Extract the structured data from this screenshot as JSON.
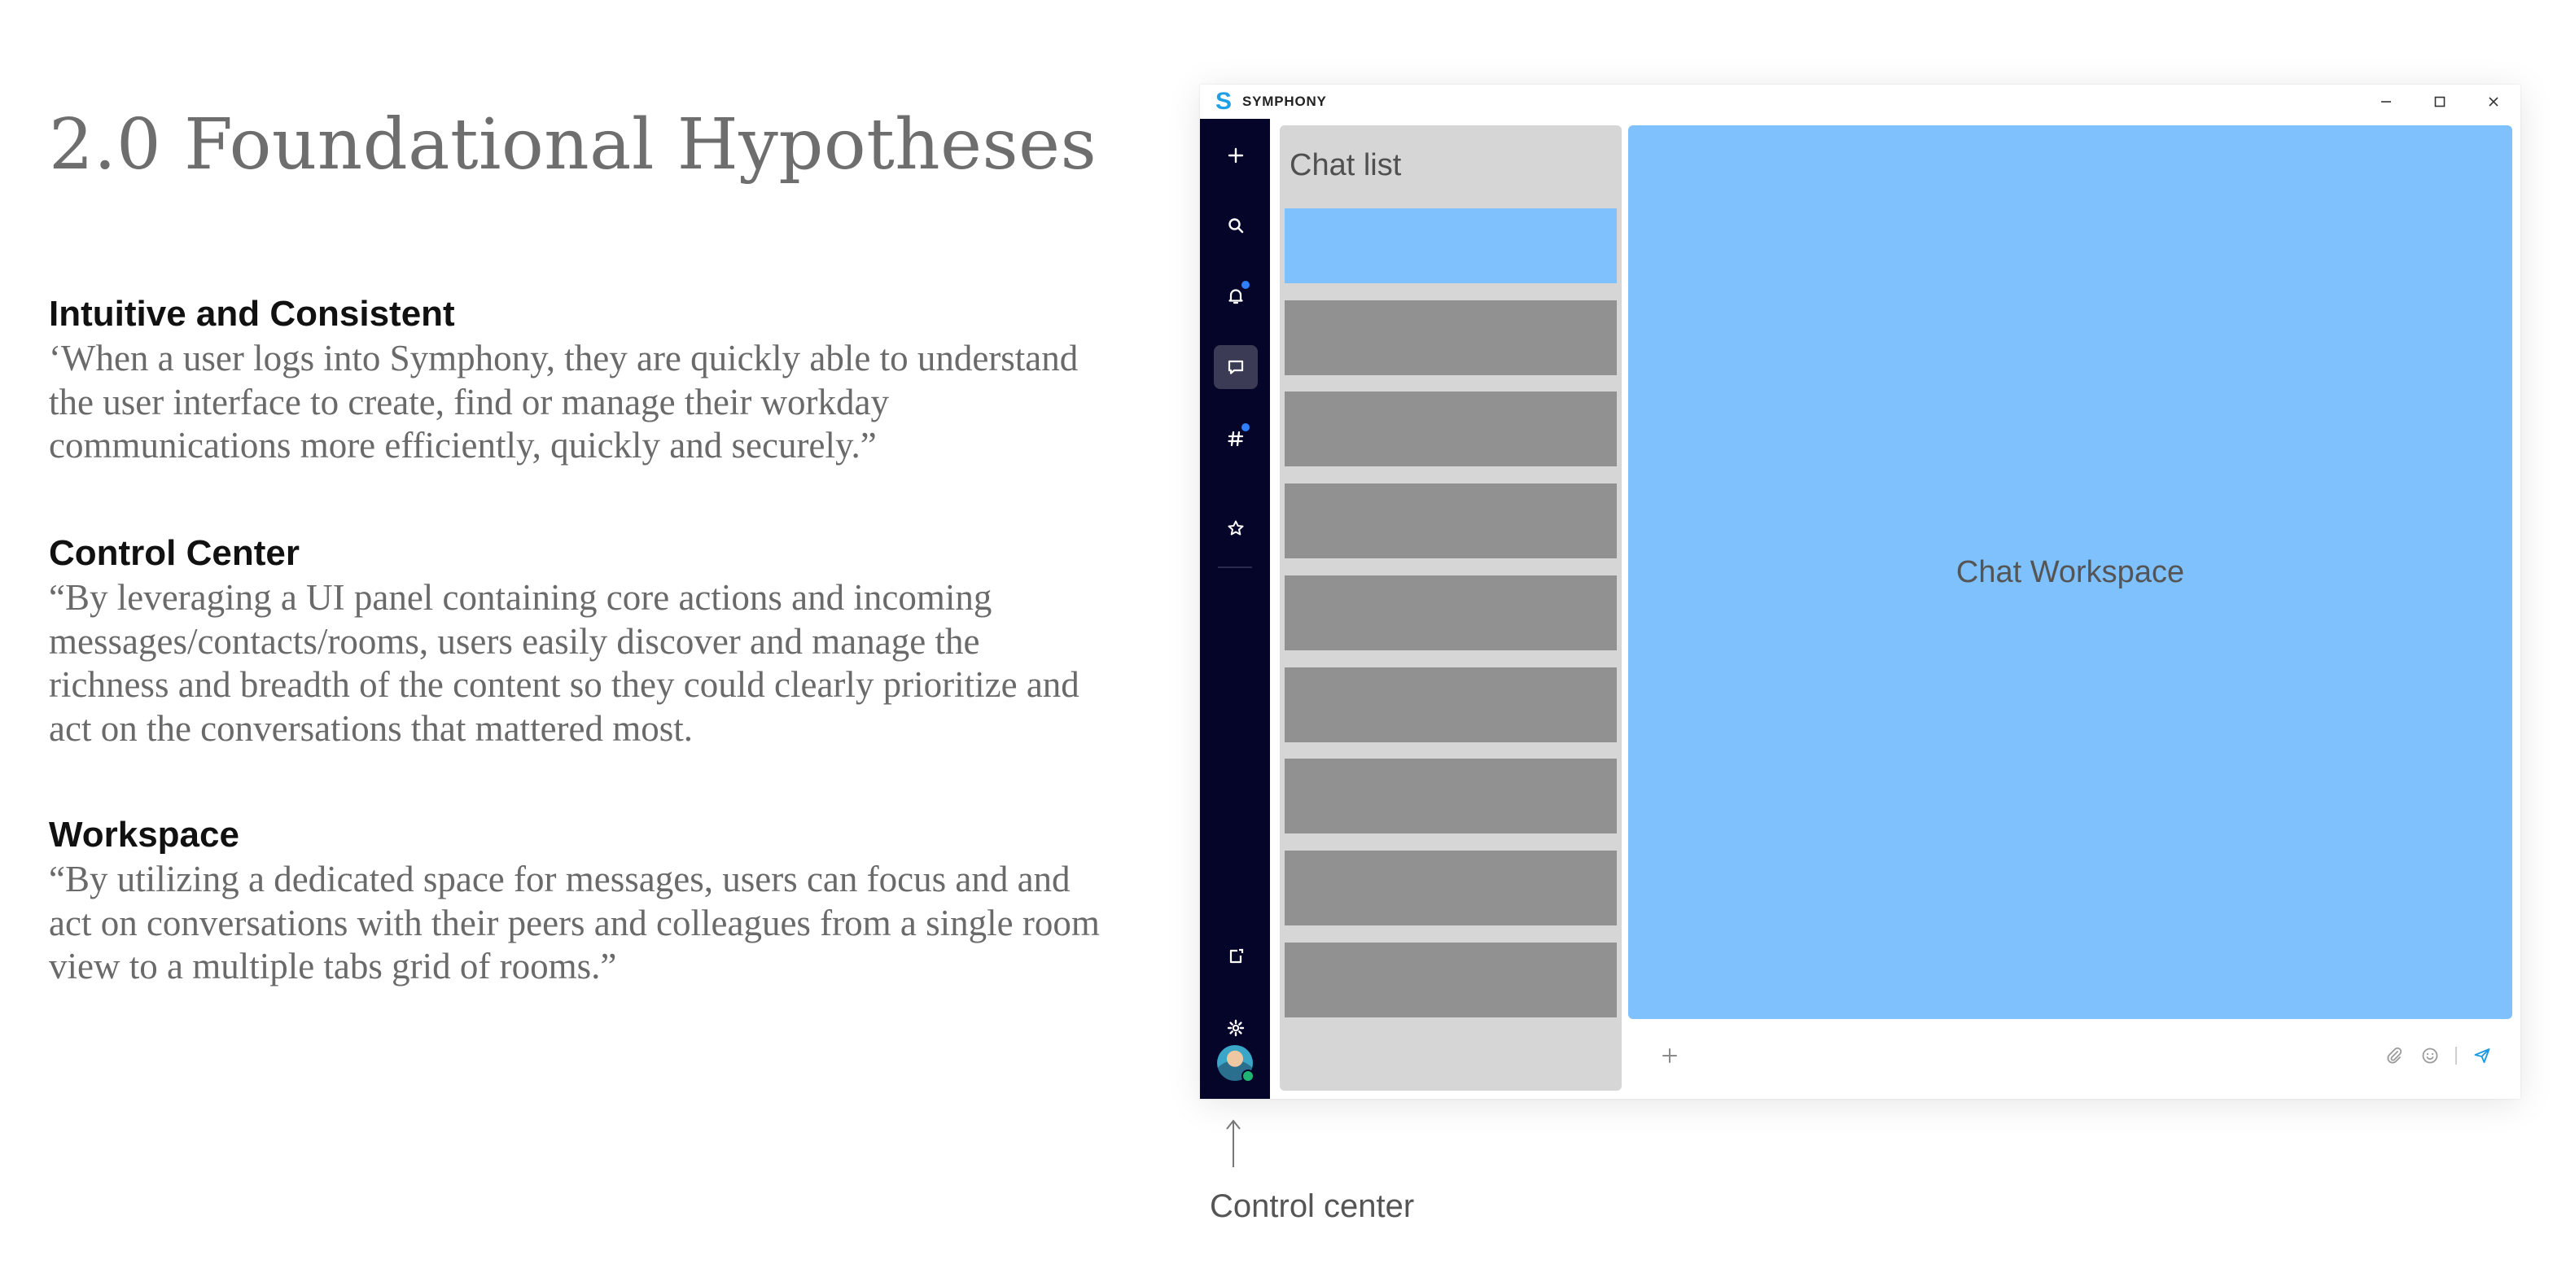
{
  "slide": {
    "title": "2.0 Foundational Hypotheses",
    "sections": [
      {
        "heading": "Intuitive and Consistent",
        "body": "‘When a user logs into Symphony, they are quickly able to understand the user interface to create, find or manage their workday communications more efficiently, quickly and securely.”"
      },
      {
        "heading": "Control Center",
        "body": "“By leveraging a UI panel containing core actions and incoming messages/contacts/rooms, users easily discover and manage the richness and breadth of the content so they could clearly prioritize and act on the conversations that mattered most."
      },
      {
        "heading": "Workspace",
        "body": "“By utilizing a dedicated space for messages, users can focus and and act on conversations with their peers and colleagues from a single room view to a multiple tabs grid of rooms.”"
      }
    ]
  },
  "app": {
    "logo_letter": "S",
    "name": "SYMPHONY",
    "window_controls": [
      "minimize-icon",
      "maximize-icon",
      "close-icon"
    ],
    "nav": {
      "items": [
        {
          "icon": "plus-icon"
        },
        {
          "icon": "search-icon"
        },
        {
          "icon": "bell-icon",
          "notification": true
        },
        {
          "icon": "chat-icon",
          "active": true
        },
        {
          "icon": "hashtag-icon",
          "notification": true
        },
        {
          "icon": "star-icon"
        },
        {
          "icon": "new-window-icon"
        },
        {
          "icon": "gear-icon"
        }
      ],
      "avatar_status": "online"
    },
    "chat_list": {
      "title": "Chat list",
      "item_count": 9,
      "selected_index": 0
    },
    "workspace": {
      "label": "Chat Workspace"
    },
    "composer": {
      "tools": [
        "plus-icon",
        "attachment-icon",
        "emoji-icon",
        "send-icon"
      ]
    }
  },
  "annotation": {
    "label": "Control center"
  },
  "colors": {
    "nav_bg": "#05052a",
    "chat_list_bg": "#d6d6d6",
    "chat_item": "#919191",
    "selected_item": "#7fc1fd",
    "workspace": "#7fc1fd",
    "accent": "#1fa0e4",
    "notification_dot": "#2f80ff"
  }
}
